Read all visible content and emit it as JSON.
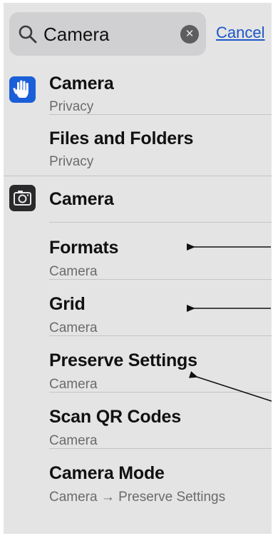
{
  "search": {
    "query": "Camera",
    "cancel_label": "Cancel"
  },
  "results": [
    {
      "title": "Camera",
      "subtitle": "Privacy",
      "icon": "privacy-hand-icon"
    },
    {
      "title": "Files and Folders",
      "subtitle": "Privacy"
    },
    {
      "title": "Camera",
      "icon": "camera-app-icon"
    },
    {
      "title": "Formats",
      "subtitle": "Camera"
    },
    {
      "title": "Grid",
      "subtitle": "Camera"
    },
    {
      "title": "Preserve Settings",
      "subtitle": "Camera"
    },
    {
      "title": "Scan QR Codes",
      "subtitle": "Camera"
    },
    {
      "title": "Camera Mode",
      "subtitle": "Camera → Preserve Settings"
    }
  ],
  "colors": {
    "background": "#e4e4e4",
    "search_field": "#d0d0d2",
    "accent_link": "#1d56c8",
    "privacy_icon": "#1a5fd8",
    "camera_icon": "#2a2a2c"
  }
}
